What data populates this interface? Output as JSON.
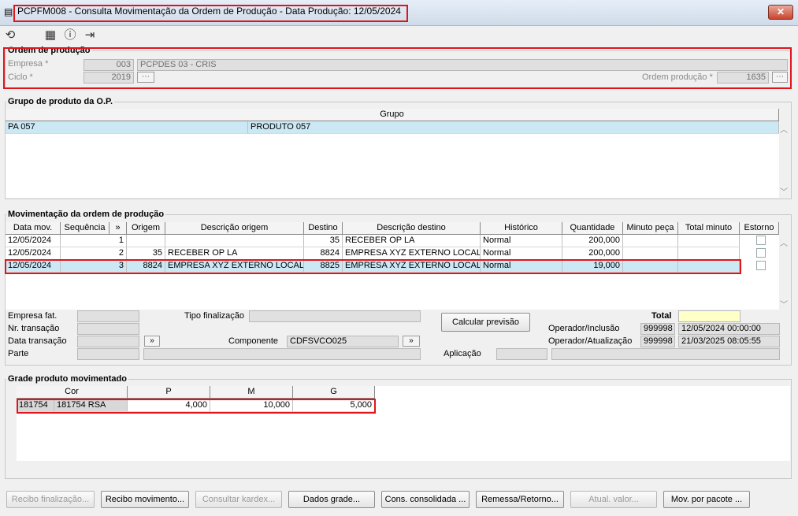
{
  "window": {
    "title": "PCPFM008 - Consulta Movimentação da Ordem de Produção - Data Produção: 12/05/2024",
    "close": "✕"
  },
  "toolbar": {
    "icons": [
      "undo-icon",
      "calendar-icon",
      "help-icon",
      "exit-icon"
    ]
  },
  "ordem": {
    "title": "Ordem de produção",
    "empresa_label": "Empresa *",
    "empresa_code": "003",
    "empresa_name": "PCPDES 03 - CRIS",
    "ciclo_label": "Ciclo *",
    "ciclo_value": "2019",
    "ordem_label": "Ordem produção *",
    "ordem_value": "1635"
  },
  "grupo": {
    "title": "Grupo de produto da O.P.",
    "header": "Grupo",
    "rows": [
      {
        "code": "PA 057",
        "name": "PRODUTO 057"
      }
    ]
  },
  "mov": {
    "title": "Movimentação da ordem de produção",
    "headers": [
      "Data mov.",
      "Sequência",
      "»",
      "Origem",
      "Descrição origem",
      "Destino",
      "Descrição destino",
      "Histórico",
      "Quantidade",
      "Minuto peça",
      "Total minuto",
      "Estorno"
    ],
    "rows": [
      [
        "12/05/2024",
        "1",
        "",
        "",
        "",
        "35",
        "RECEBER OP LA",
        "Normal",
        "200,000",
        "",
        ""
      ],
      [
        "12/05/2024",
        "2",
        "",
        "35",
        "RECEBER OP LA",
        "8824",
        "EMPRESA XYZ EXTERNO LOCAL C",
        "Normal",
        "200,000",
        "",
        ""
      ],
      [
        "12/05/2024",
        "3",
        "",
        "8824",
        "EMPRESA XYZ EXTERNO LOCAL C",
        "8825",
        "EMPRESA XYZ EXTERNO LOCAL C",
        "Normal",
        "19,000",
        "",
        ""
      ]
    ]
  },
  "details": {
    "empresa_fat": "Empresa fat.",
    "nr_transacao": "Nr. transação",
    "data_transacao": "Data transação",
    "parte": "Parte",
    "tipo_finalizacao": "Tipo finalização",
    "componente": "Componente",
    "componente_value": "CDFSVCO025",
    "calcular": "Calcular previsão",
    "aplicacao": "Aplicação",
    "total": "Total",
    "op_inclusao": "Operador/Inclusão",
    "op_inclusao_code": "999998",
    "op_inclusao_date": "12/05/2024 00:00:00",
    "op_atualizacao": "Operador/Atualização",
    "op_atualizacao_code": "999998",
    "op_atualizacao_date": "21/03/2025 08:05:55",
    "arrow": "»"
  },
  "grade": {
    "title": "Grade produto movimentado",
    "headers": [
      "Cor",
      "P",
      "M",
      "G"
    ],
    "row": {
      "code": "181754",
      "name": "181754 RSA",
      "p": "4,000",
      "m": "10,000",
      "g": "5,000"
    }
  },
  "buttons": [
    "Recibo finalização...",
    "Recibo movimento...",
    "Consultar kardex...",
    "Dados grade...",
    "Cons. consolidada ...",
    "Remessa/Retorno...",
    "Atual. valor...",
    "Mov. por pacote ..."
  ]
}
